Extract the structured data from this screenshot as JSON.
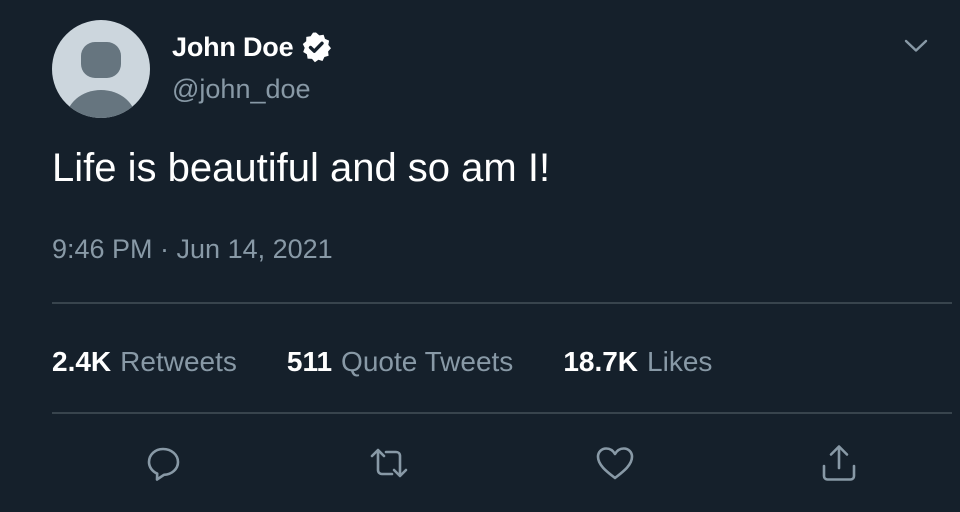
{
  "user": {
    "display_name": "John Doe",
    "handle": "@john_doe",
    "verified": true
  },
  "tweet": {
    "text": "Life is beautiful and so am I!",
    "timestamp": "9:46 PM · Jun 14, 2021"
  },
  "stats": {
    "retweets_count": "2.4K",
    "retweets_label": "Retweets",
    "quotes_count": "511",
    "quotes_label": "Quote Tweets",
    "likes_count": "18.7K",
    "likes_label": "Likes"
  },
  "icons": {
    "verified": "verified-badge-icon",
    "menu": "chevron-down-icon",
    "reply": "reply-icon",
    "retweet": "retweet-icon",
    "like": "heart-icon",
    "share": "share-icon"
  },
  "colors": {
    "background": "#15202b",
    "text_primary": "#ffffff",
    "text_secondary": "#8899a6",
    "divider": "#38444d"
  }
}
